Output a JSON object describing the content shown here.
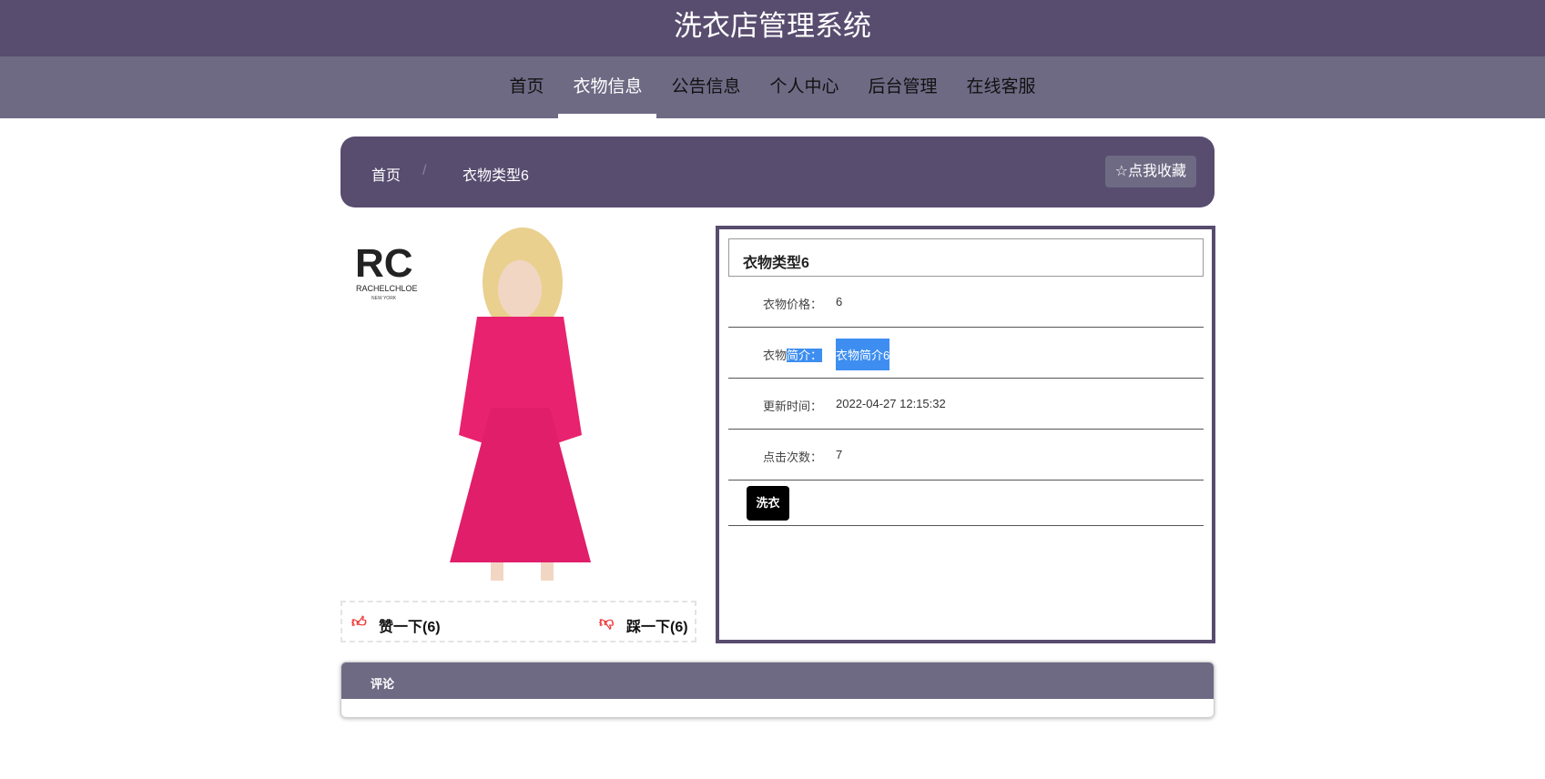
{
  "header": {
    "title": "洗衣店管理系统"
  },
  "nav": {
    "items": [
      "首页",
      "衣物信息",
      "公告信息",
      "个人中心",
      "后台管理",
      "在线客服"
    ],
    "active": 1
  },
  "breadcrumb": {
    "home": "首页",
    "sep": "/",
    "current": "衣物类型6",
    "favorite": "点我收藏"
  },
  "product": {
    "logo": "RC",
    "logo_sub": "RACHELCHLOE",
    "logo_city": "NEW YORK",
    "like": "赞一下(6)",
    "dislike": "踩一下(6)"
  },
  "detail": {
    "title": "衣物类型6",
    "rows": [
      {
        "label_a": "衣物价格：",
        "value": "6"
      },
      {
        "label_a": "衣物",
        "label_b": "简介：",
        "value": "衣物简介6"
      },
      {
        "label_a": "更新时间：",
        "value": "2022-04-27 12:15:32"
      },
      {
        "label_a": "点击次数：",
        "value": "7"
      }
    ],
    "wash_button": "洗衣"
  },
  "comments": {
    "title": "评论"
  },
  "colors": {
    "primary": "#584c6f",
    "secondary": "#6e6a84",
    "selection": "#3d8ef0"
  }
}
